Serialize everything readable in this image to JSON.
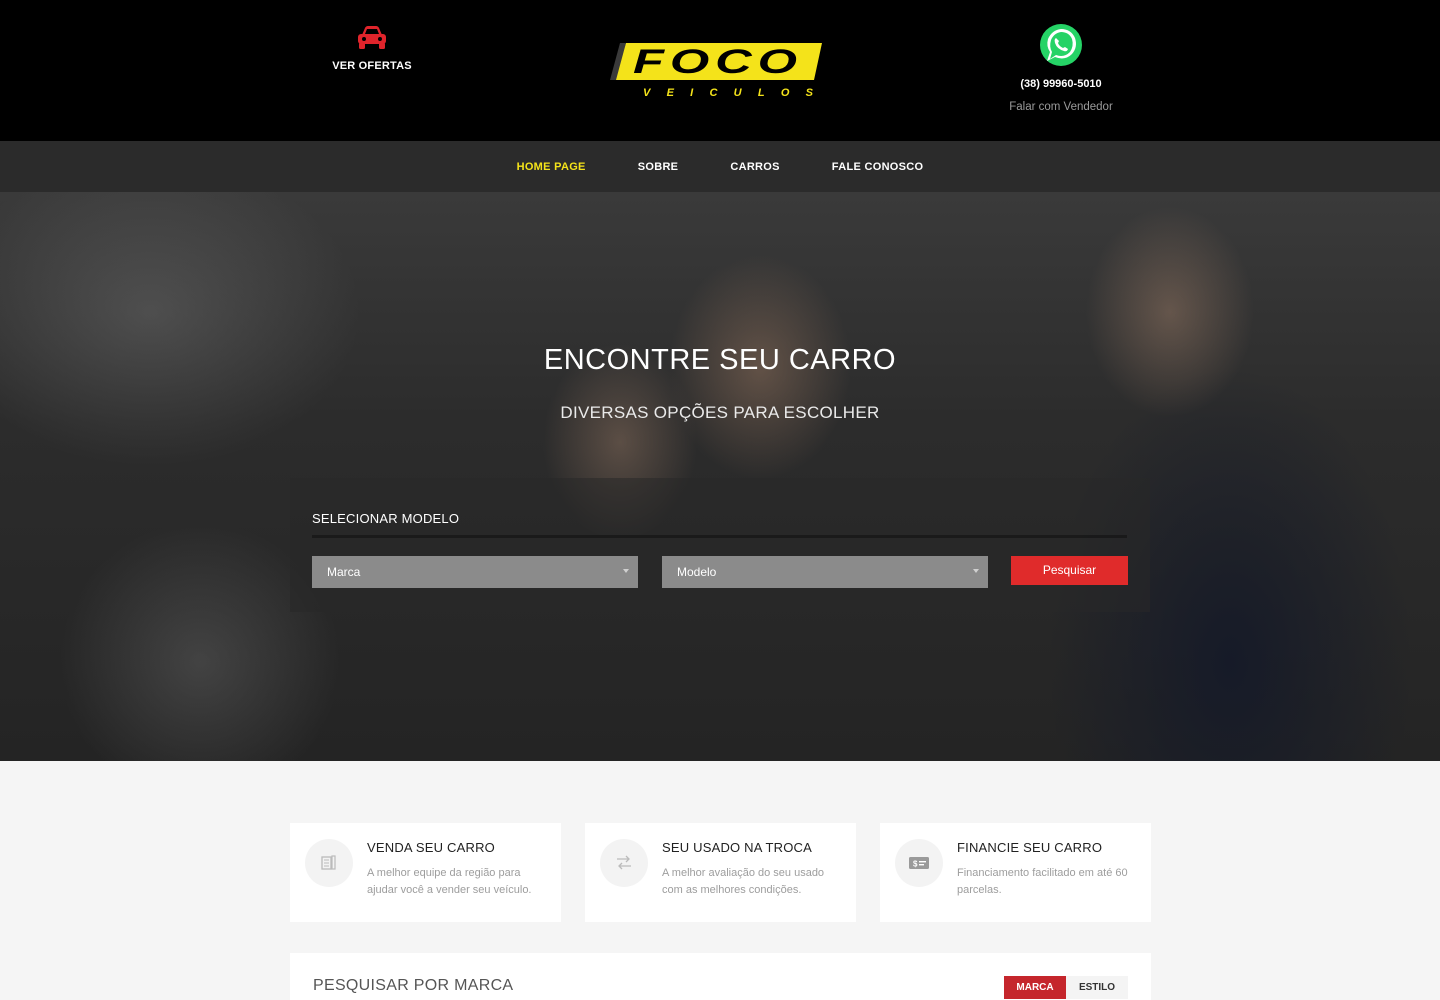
{
  "header": {
    "offers_label": "VER OFERTAS",
    "logo_main": "FOCO",
    "logo_sub": "VEICULOS",
    "phone": "(38) 99960-5010",
    "seller_label": "Falar com Vendedor"
  },
  "nav": {
    "items": [
      {
        "label": "HOME PAGE",
        "active": true
      },
      {
        "label": "SOBRE",
        "active": false
      },
      {
        "label": "CARROS",
        "active": false
      },
      {
        "label": "FALE CONOSCO",
        "active": false
      }
    ]
  },
  "hero": {
    "title": "ENCONTRE SEU CARRO",
    "subtitle": "DIVERSAS OPÇÕES PARA ESCOLHER",
    "search": {
      "label": "SELECIONAR MODELO",
      "brand_value": "Marca",
      "model_value": "Modelo",
      "button_label": "Pesquisar"
    }
  },
  "features": [
    {
      "title": "VENDA SEU CARRO",
      "description": "A melhor equipe da região para ajudar você a vender seu veículo.",
      "icon": "document-icon"
    },
    {
      "title": "SEU USADO NA TROCA",
      "description": "A melhor avaliação do seu usado com as melhores condições.",
      "icon": "exchange-icon"
    },
    {
      "title": "FINANCIE SEU CARRO",
      "description": "Financiamento facilitado em até 60 parcelas.",
      "icon": "payment-card-icon"
    }
  ],
  "brand_search": {
    "title": "PESQUISAR POR MARCA",
    "tabs": [
      {
        "label": "MARCA",
        "active": true
      },
      {
        "label": "ESTILO",
        "active": false
      }
    ]
  },
  "colors": {
    "accent_yellow": "#f4e31a",
    "accent_red": "#e02b2b",
    "header_bg": "#000000",
    "nav_bg": "#2b2b2b",
    "whatsapp_green": "#25d366"
  }
}
